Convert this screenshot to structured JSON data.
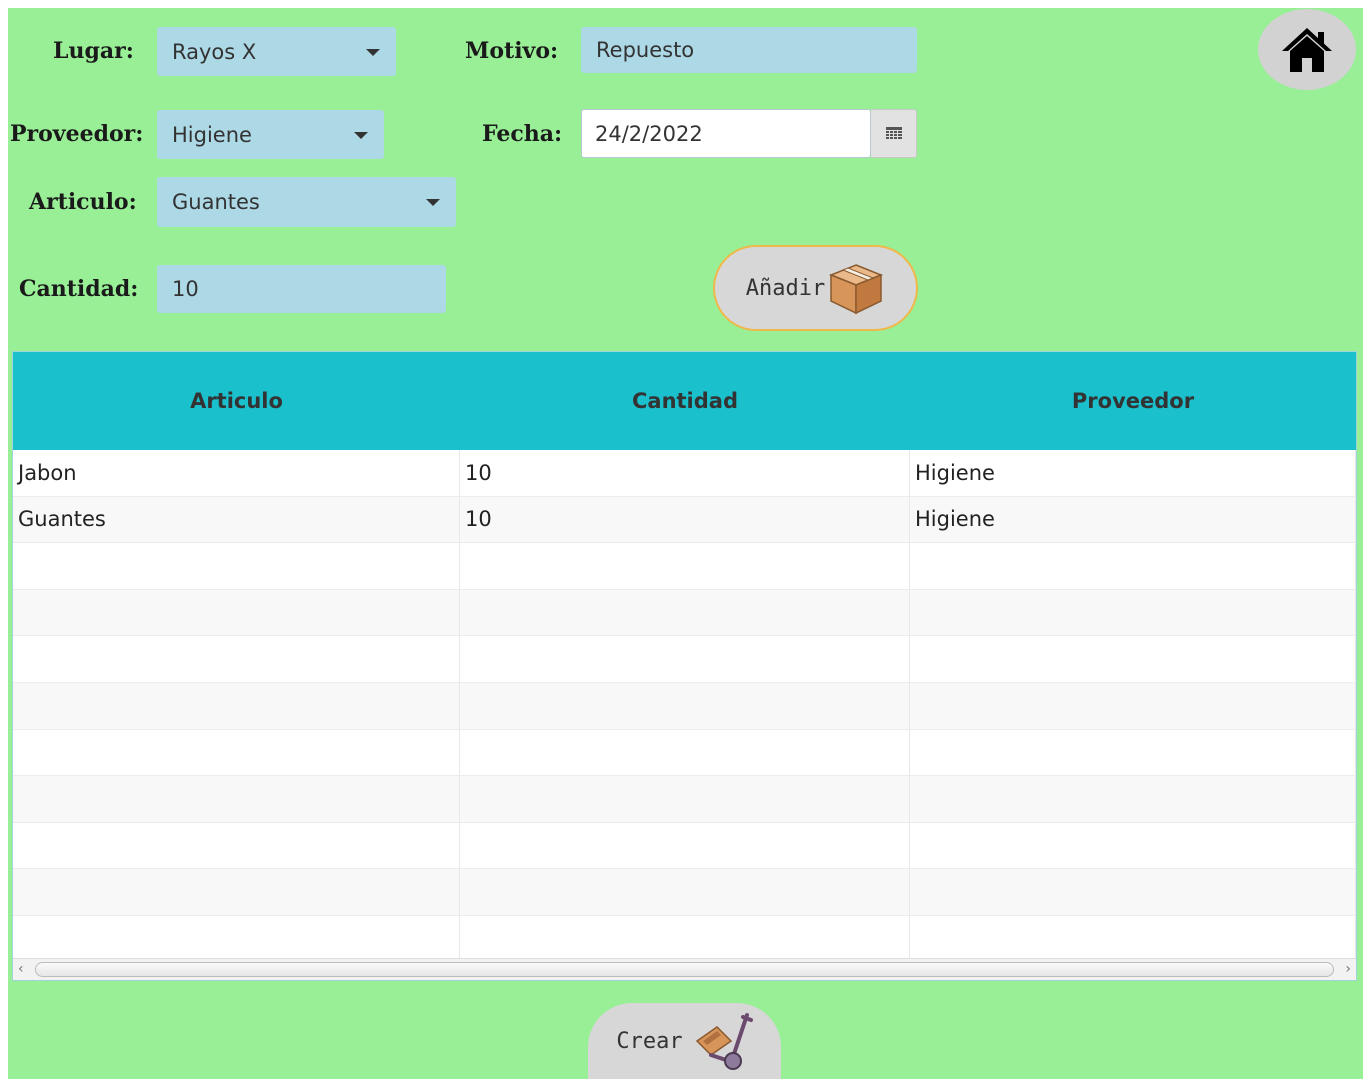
{
  "form": {
    "lugar": {
      "label": "Lugar:",
      "value": "Rayos X"
    },
    "motivo": {
      "label": "Motivo:",
      "value": "Repuesto"
    },
    "proveedor": {
      "label": "Proveedor:",
      "value": "Higiene"
    },
    "fecha": {
      "label": "Fecha:",
      "value": "24/2/2022"
    },
    "articulo": {
      "label": "Articulo:",
      "value": "Guantes"
    },
    "cantidad": {
      "label": "Cantidad:",
      "value": "10"
    }
  },
  "buttons": {
    "add_label": "Añadir",
    "create_label": "Crear"
  },
  "table": {
    "headers": [
      "Articulo",
      "Cantidad",
      "Proveedor"
    ],
    "rows": [
      [
        "Jabon",
        "10",
        "Higiene"
      ],
      [
        "Guantes",
        "10",
        "Higiene"
      ]
    ]
  },
  "icons": {
    "home": "home-icon",
    "calendar": "calendar-icon",
    "add": "box-icon",
    "create": "hand-truck-icon"
  },
  "colors": {
    "background": "#98ef96",
    "field": "#add8e6",
    "table_header": "#1ac1cd",
    "add_border": "#f0b84a",
    "button": "#d7d7d7"
  }
}
